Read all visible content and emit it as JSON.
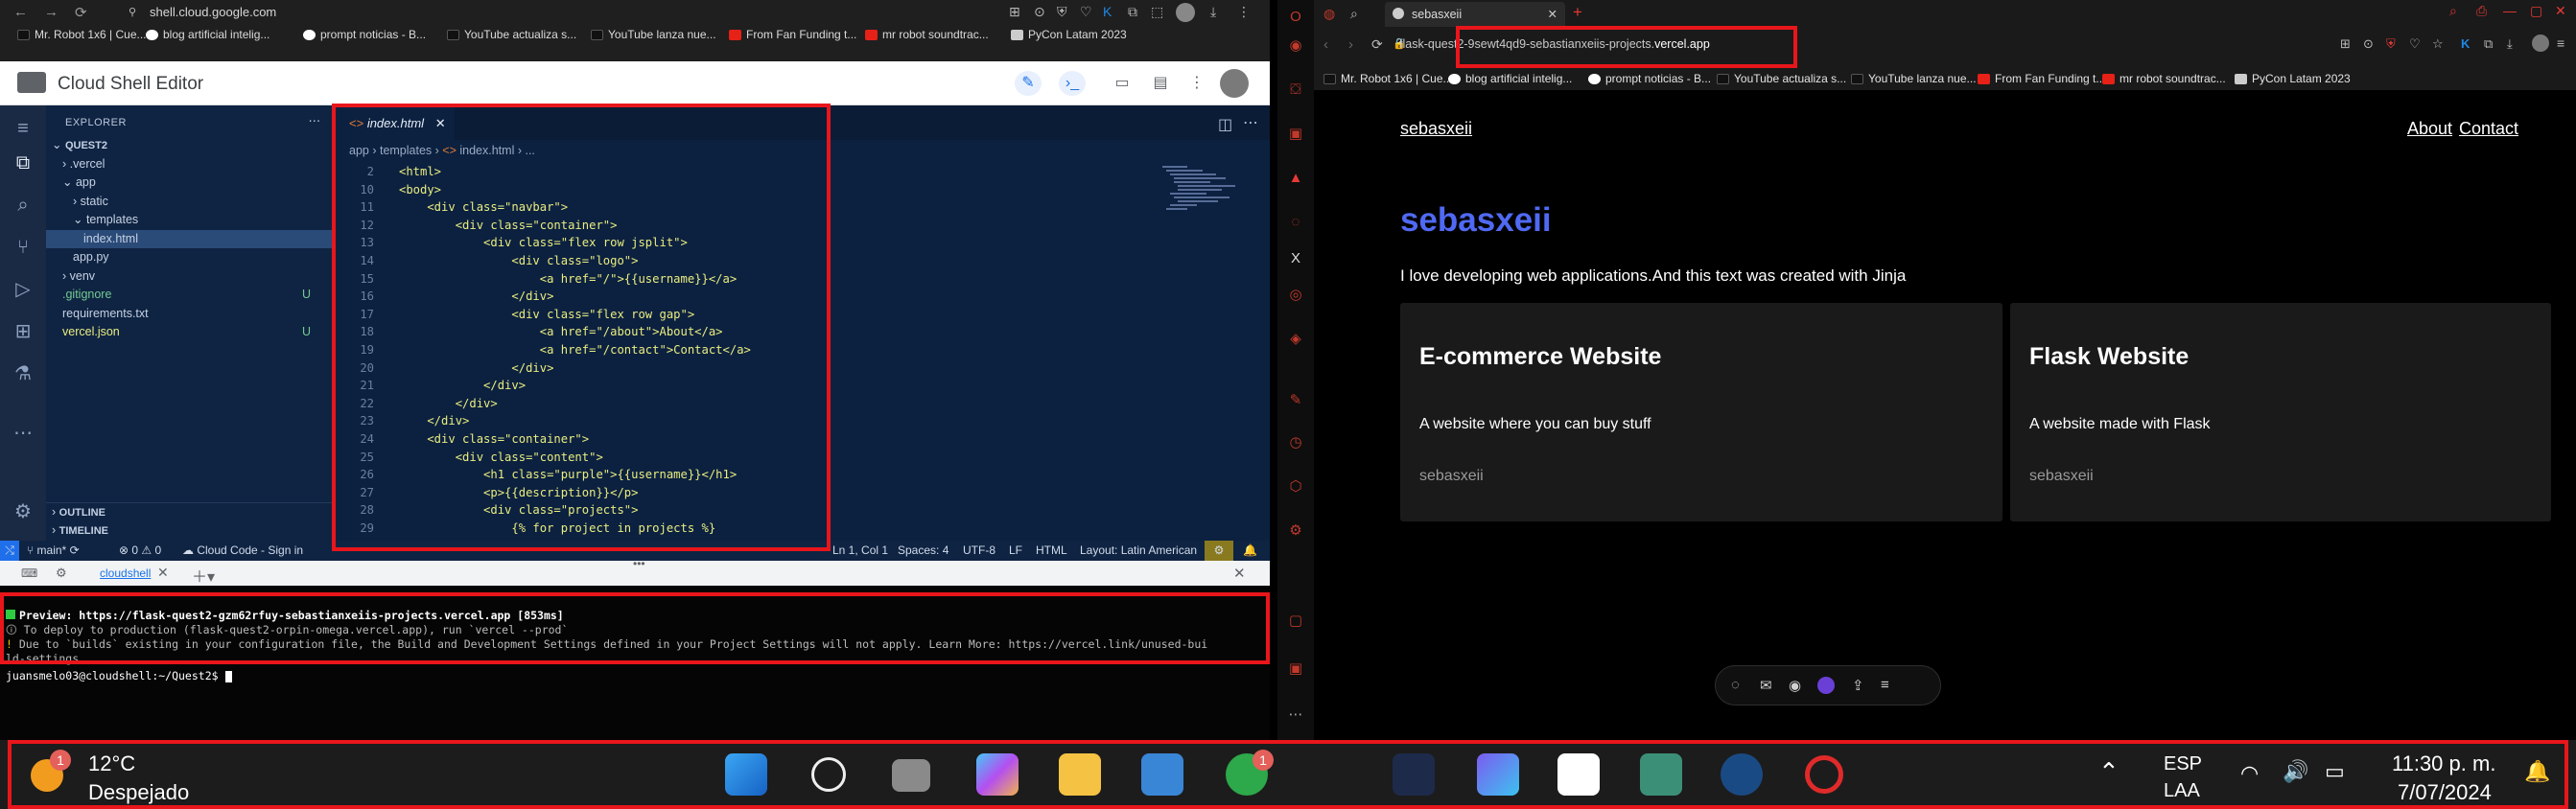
{
  "left_browser": {
    "url": "shell.cloud.google.com",
    "bookmarks": [
      "Mr. Robot 1x6 | Cue...",
      "blog artificial intelig...",
      "prompt noticias - B...",
      "YouTube actualiza s...",
      "YouTube lanza nue...",
      "From Fan Funding t...",
      "mr robot soundtrac...",
      "PyCon Latam 2023"
    ]
  },
  "cloud_shell": {
    "title": "Cloud Shell Editor",
    "explorer": {
      "title": "EXPLORER",
      "items": [
        {
          "label": "QUEST2",
          "indent": 0,
          "arrow": "v",
          "bold": true
        },
        {
          "label": ".vercel",
          "indent": 1,
          "arrow": ">"
        },
        {
          "label": "app",
          "indent": 1,
          "arrow": "v"
        },
        {
          "label": "static",
          "indent": 2,
          "arrow": ">"
        },
        {
          "label": "templates",
          "indent": 2,
          "arrow": "v"
        },
        {
          "label": "index.html",
          "indent": 3,
          "arrow": "",
          "selected": true
        },
        {
          "label": "app.py",
          "indent": 2,
          "arrow": ""
        },
        {
          "label": "venv",
          "indent": 1,
          "arrow": ">"
        },
        {
          "label": ".gitignore",
          "indent": 1,
          "arrow": "",
          "badge": "U"
        },
        {
          "label": "requirements.txt",
          "indent": 1,
          "arrow": ""
        },
        {
          "label": "vercel.json",
          "indent": 1,
          "arrow": "",
          "badge": "U"
        }
      ],
      "outline": "OUTLINE",
      "timeline": "TIMELINE"
    },
    "editor": {
      "tab": "index.html",
      "breadcrumb": [
        "app",
        "templates",
        "index.html",
        "..."
      ],
      "lines": [
        {
          "n": "2",
          "code": "<html>"
        },
        {
          "n": "10",
          "code": "<body>"
        },
        {
          "n": "11",
          "code": "    <div class=\"navbar\">"
        },
        {
          "n": "12",
          "code": "        <div class=\"container\">"
        },
        {
          "n": "13",
          "code": "            <div class=\"flex row jsplit\">"
        },
        {
          "n": "14",
          "code": "                <div class=\"logo\">"
        },
        {
          "n": "15",
          "code": "                    <a href=\"/\">{{username}}</a>"
        },
        {
          "n": "16",
          "code": "                </div>"
        },
        {
          "n": "17",
          "code": "                <div class=\"flex row gap\">"
        },
        {
          "n": "18",
          "code": "                    <a href=\"/about\">About</a>"
        },
        {
          "n": "19",
          "code": "                    <a href=\"/contact\">Contact</a>"
        },
        {
          "n": "20",
          "code": "                </div>"
        },
        {
          "n": "21",
          "code": "            </div>"
        },
        {
          "n": "22",
          "code": "        </div>"
        },
        {
          "n": "23",
          "code": "    </div>"
        },
        {
          "n": "24",
          "code": "    <div class=\"container\">"
        },
        {
          "n": "25",
          "code": "        <div class=\"content\">"
        },
        {
          "n": "26",
          "code": "            <h1 class=\"purple\">{{username}}</h1>"
        },
        {
          "n": "27",
          "code": "            <p>{{description}}</p>"
        },
        {
          "n": "28",
          "code": "            <div class=\"projects\">"
        },
        {
          "n": "29",
          "code": "                {% for project in projects %}"
        }
      ]
    },
    "statusbar": {
      "branch": "main*",
      "problems": "⊗ 0 ⚠ 0",
      "cloud_code": "Cloud Code - Sign in",
      "position": "Ln 1, Col 1",
      "spaces": "Spaces: 4",
      "encoding": "UTF-8",
      "eol": "LF",
      "language": "HTML",
      "layout": "Layout: Latin American"
    },
    "terminal": {
      "tab": "cloudshell",
      "lines": [
        "Preview: https://flask-quest2-gzm62rfuy-sebastianxeiis-projects.vercel.app [853ms]",
        "To deploy to production (flask-quest2-orpin-omega.vercel.app), run `vercel --prod`",
        "Due to `builds` existing in your configuration file, the Build and Development Settings defined in your Project Settings will not apply. Learn More: https://vercel.link/unused-bui",
        "ld-settings",
        "juansmelo03@cloudshell:~/Quest2$"
      ]
    }
  },
  "opera": {
    "tab_title": "sebasxeii",
    "url_prefix": "flask-quest2-9sewt4qd9-sebastianxeiis-projects.",
    "url_domain": "vercel.app",
    "bookmarks": [
      "Mr. Robot 1x6 | Cue...",
      "blog artificial intelig...",
      "prompt noticias - B...",
      "YouTube actualiza s...",
      "YouTube lanza nue...",
      "From Fan Funding t...",
      "mr robot soundtrac...",
      "PyCon Latam 2023"
    ]
  },
  "site": {
    "username_link": "sebasxeii",
    "nav": [
      "About",
      "Contact"
    ],
    "heading": "sebasxeii",
    "description": "I love developing web applications.And this text was created with Jinja",
    "cards": [
      {
        "title": "E-commerce Website",
        "text": "A website where you can buy stuff",
        "user": "sebasxeii"
      },
      {
        "title": "Flask Website",
        "text": "A website made with Flask",
        "user": "sebasxeii"
      }
    ]
  },
  "taskbar": {
    "temperature": "12°C",
    "weather": "Despejado",
    "weather_badge": "1",
    "xbox_badge": "1",
    "lang_top": "ESP",
    "lang_bottom": "LAA",
    "time": "11:30 p. m.",
    "date": "7/07/2024"
  },
  "colors": {
    "highlight": "#e8161b",
    "site_heading": "#5069f3",
    "editor_bg": "#0c2140"
  }
}
